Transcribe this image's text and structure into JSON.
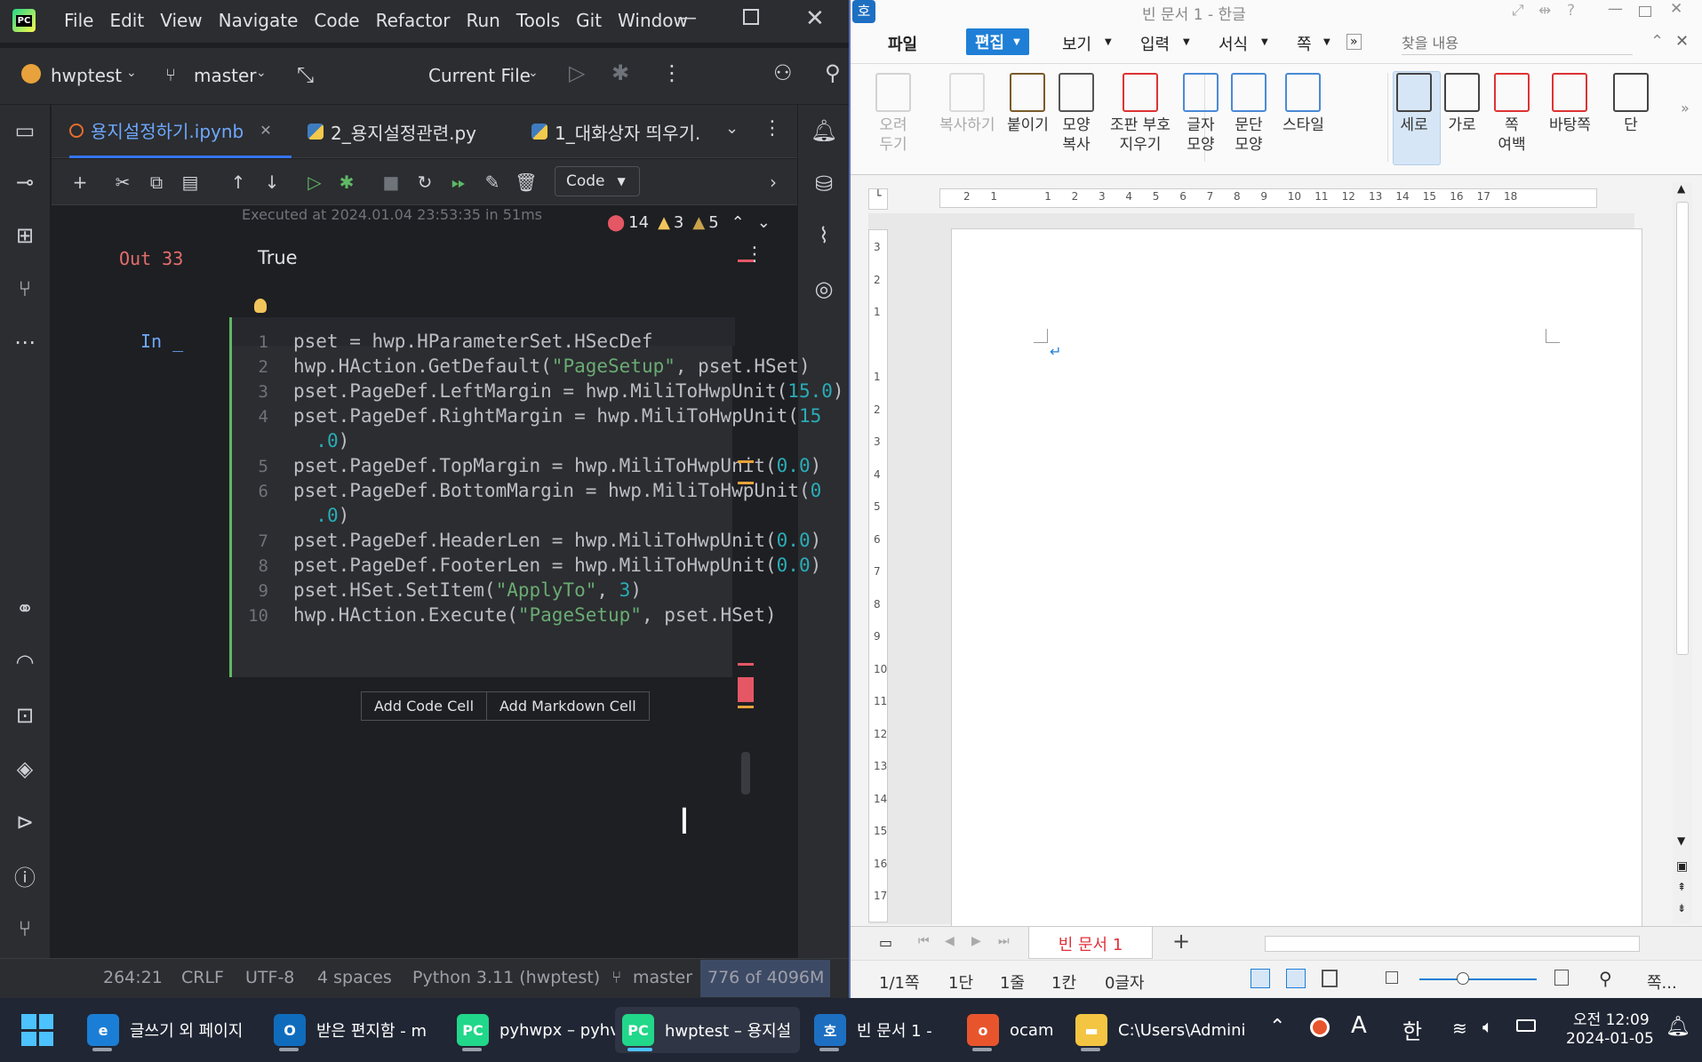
{
  "ide": {
    "menu": [
      "File",
      "Edit",
      "View",
      "Navigate",
      "Code",
      "Refactor",
      "Run",
      "Tools",
      "Git",
      "Window"
    ],
    "project": "hwptest",
    "branch": "master",
    "run_config": "Current File",
    "tabs": [
      "용지설정하기.ipynb",
      "2_용지설정관련.py",
      "1_대화상자 띄우기."
    ],
    "cell_type": "Code",
    "executed": "Executed at 2024.01.04 23:53:35 in 51ms",
    "inspections": {
      "errors": "14",
      "warnings": "3",
      "weak": "5"
    },
    "out_label": "Out 33",
    "out_value": "True",
    "in_label": "In _",
    "code_lines": [
      "pset = hwp.HParameterSet.HSecDef",
      "hwp.HAction.GetDefault(\"PageSetup\", pset.HSet)",
      "pset.PageDef.LeftMargin = hwp.MiliToHwpUnit(15.0)",
      "pset.PageDef.RightMargin = hwp.MiliToHwpUnit(15",
      "  .0)",
      "pset.PageDef.TopMargin = hwp.MiliToHwpUnit(0.0)",
      "pset.PageDef.BottomMargin = hwp.MiliToHwpUnit(0",
      "  .0)",
      "pset.PageDef.HeaderLen = hwp.MiliToHwpUnit(0.0)",
      "pset.PageDef.FooterLen = hwp.MiliToHwpUnit(0.0)",
      "pset.HSet.SetItem(\"ApplyTo\", 3)",
      "hwp.HAction.Execute(\"PageSetup\", pset.HSet)"
    ],
    "line_numbers": [
      "1",
      "2",
      "3",
      "4",
      "",
      "5",
      "6",
      "",
      "7",
      "8",
      "9",
      "10"
    ],
    "add_code_cell": "Add Code Cell",
    "add_markdown_cell": "Add Markdown Cell",
    "status": {
      "pos": "264:21",
      "eol": "CRLF",
      "enc": "UTF-8",
      "indent": "4 spaces",
      "interp": "Python 3.11 (hwptest)",
      "branch": "master",
      "memory": "776 of 4096M"
    }
  },
  "hwp": {
    "title": "빈 문서 1 - 한글",
    "menu": [
      "파일",
      "편집",
      "보기",
      "입력",
      "서식",
      "쪽"
    ],
    "search_placeholder": "찾을 내용",
    "ribbon": [
      {
        "label": "오려\n두기",
        "disabled": true
      },
      {
        "label": "복사하기",
        "disabled": true
      },
      {
        "label": "붙이기",
        "disabled": false
      },
      {
        "label": "모양\n복사",
        "disabled": false
      },
      {
        "label": "조판 부호\n지우기",
        "disabled": false
      },
      {
        "label": "글자\n모양",
        "disabled": false
      },
      {
        "label": "문단\n모양",
        "disabled": false
      },
      {
        "label": "스타일",
        "disabled": false
      },
      {
        "label": "세로",
        "disabled": false
      },
      {
        "label": "가로",
        "disabled": false
      },
      {
        "label": "쪽\n여백",
        "disabled": false
      },
      {
        "label": "바탕쪽",
        "disabled": false
      },
      {
        "label": "단",
        "disabled": false
      }
    ],
    "ruler_h": [
      "2",
      "1",
      "",
      "1",
      "2",
      "3",
      "4",
      "5",
      "6",
      "7",
      "8",
      "9",
      "10",
      "11",
      "12",
      "13",
      "14",
      "15",
      "16",
      "17",
      "18"
    ],
    "ruler_v": [
      "3",
      "2",
      "1",
      "",
      "1",
      "2",
      "3",
      "4",
      "5",
      "6",
      "7",
      "8",
      "9",
      "10",
      "11",
      "12",
      "13",
      "14",
      "15",
      "16",
      "17"
    ],
    "doc_tab": "빈 문서 1",
    "status": {
      "page": "1/1쪽",
      "col": "1단",
      "line": "1줄",
      "pos": "1칸",
      "chars": "0글자",
      "zoom": "쪽..."
    }
  },
  "taskbar": {
    "items": [
      {
        "label": "글쓰기 외 페이지",
        "color": "#1b7ed6"
      },
      {
        "label": "받은 편지함 - m",
        "color": "#0f6cbd"
      },
      {
        "label": "pyhwpx – pyhv",
        "color": "#21d789"
      },
      {
        "label": "hwptest – 용지설",
        "color": "#21d789"
      },
      {
        "label": "빈 문서 1 -",
        "color": "#1d6fc2"
      },
      {
        "label": "ocam",
        "color": "#e8552d"
      },
      {
        "label": "C:\\Users\\Admini",
        "color": "#f4c542"
      }
    ],
    "ime": "한",
    "time": "오전 12:09",
    "date": "2024-01-05"
  }
}
